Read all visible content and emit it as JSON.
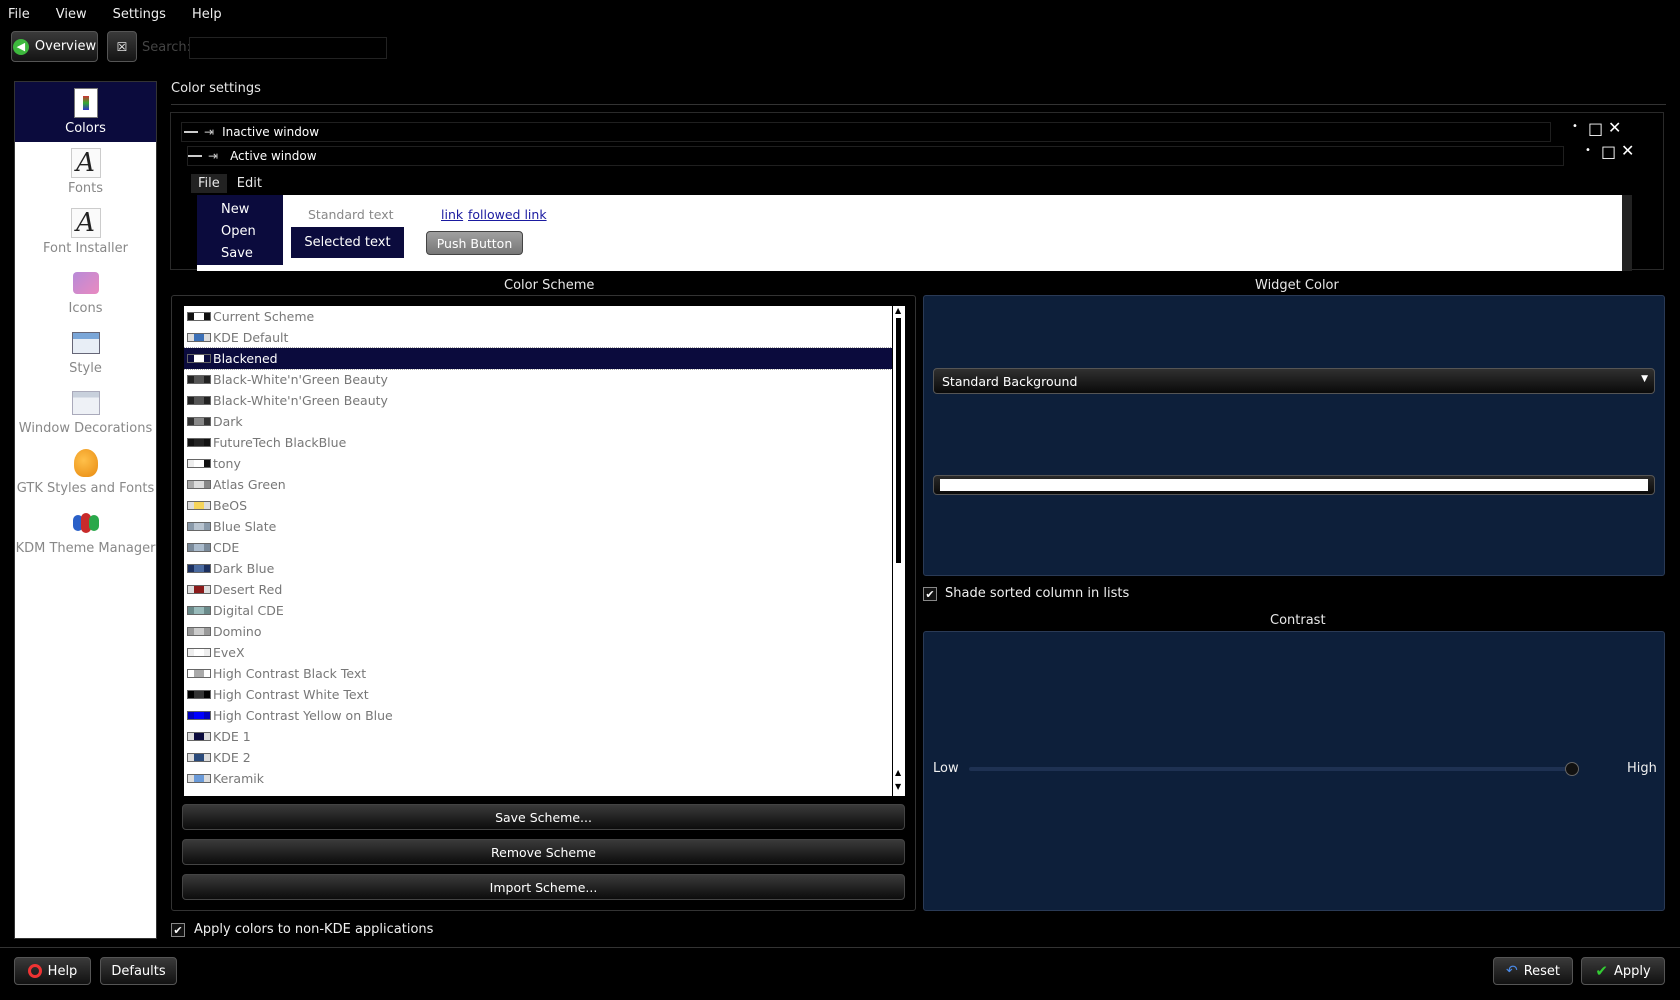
{
  "menubar": {
    "items": [
      "File",
      "View",
      "Settings",
      "Help"
    ]
  },
  "toolbar": {
    "overview_label": "Overview",
    "search_label": "Search:",
    "search_value": ""
  },
  "sidebar": {
    "items": [
      {
        "label": "Colors",
        "icon": "colors-icon"
      },
      {
        "label": "Fonts",
        "icon": "fonts-icon"
      },
      {
        "label": "Font Installer",
        "icon": "font-installer-icon"
      },
      {
        "label": "Icons",
        "icon": "icons-icon"
      },
      {
        "label": "Style",
        "icon": "style-icon"
      },
      {
        "label": "Window Decorations",
        "icon": "window-decorations-icon"
      },
      {
        "label": "GTK Styles and Fonts",
        "icon": "gtk-icon"
      },
      {
        "label": "KDM Theme Manager",
        "icon": "kdm-icon"
      }
    ]
  },
  "main": {
    "title": "Color settings"
  },
  "preview": {
    "inactive_title": "Inactive window",
    "active_title": "Active window",
    "menu_file": "File",
    "menu_edit": "Edit",
    "menu_items": [
      "New",
      "Open",
      "Save"
    ],
    "standard_text": "Standard text",
    "selected_text": "Selected text",
    "link": "link",
    "followed_link": "followed link",
    "push_button": "Push Button"
  },
  "color_scheme": {
    "title": "Color Scheme",
    "items": [
      {
        "name": "Current Scheme",
        "swatch": [
          "#111",
          "#fff",
          "#111"
        ]
      },
      {
        "name": "KDE Default",
        "swatch": [
          "#ddd",
          "#3b6fb6",
          "#ddd"
        ]
      },
      {
        "name": "Blackened",
        "swatch": [
          "#0b0b3d",
          "#fff",
          "#0b0b3d"
        ],
        "selected": true
      },
      {
        "name": "Black-White'n'Green Beauty",
        "swatch": [
          "#222",
          "#555",
          "#222"
        ]
      },
      {
        "name": "Black-White'n'Green Beauty",
        "swatch": [
          "#222",
          "#555",
          "#222"
        ]
      },
      {
        "name": "Dark",
        "swatch": [
          "#333",
          "#888",
          "#333"
        ]
      },
      {
        "name": "FutureTech BlackBlue",
        "swatch": [
          "#111",
          "#222",
          "#111"
        ]
      },
      {
        "name": "tony",
        "swatch": [
          "#eee",
          "#fff",
          "#111"
        ]
      },
      {
        "name": "Atlas Green",
        "swatch": [
          "#aaa",
          "#ddd",
          "#888"
        ]
      },
      {
        "name": "BeOS",
        "swatch": [
          "#ddd",
          "#f5d45a",
          "#ddd"
        ]
      },
      {
        "name": "Blue Slate",
        "swatch": [
          "#8a9aaa",
          "#b8c4d0",
          "#8a9aaa"
        ]
      },
      {
        "name": "CDE",
        "swatch": [
          "#7a8a9a",
          "#aabbcc",
          "#7a8a9a"
        ]
      },
      {
        "name": "Dark Blue",
        "swatch": [
          "#1c3060",
          "#4a6aa0",
          "#1c3060"
        ]
      },
      {
        "name": "Desert Red",
        "swatch": [
          "#ddd",
          "#8a1a1a",
          "#ddd"
        ]
      },
      {
        "name": "Digital CDE",
        "swatch": [
          "#6a8a8a",
          "#99bbbb",
          "#6a8a8a"
        ]
      },
      {
        "name": "Domino",
        "swatch": [
          "#999",
          "#ccc",
          "#999"
        ]
      },
      {
        "name": "EveX",
        "swatch": [
          "#eee",
          "#fff",
          "#eee"
        ]
      },
      {
        "name": "High Contrast Black Text",
        "swatch": [
          "#fff",
          "#aaa",
          "#fff"
        ]
      },
      {
        "name": "High Contrast White Text",
        "swatch": [
          "#000",
          "#333",
          "#000"
        ]
      },
      {
        "name": "High Contrast Yellow on Blue",
        "swatch": [
          "#0000c0",
          "#0000ff",
          "#0000c0"
        ]
      },
      {
        "name": "KDE 1",
        "swatch": [
          "#ddd",
          "#0b0b3d",
          "#ddd"
        ]
      },
      {
        "name": "KDE 2",
        "swatch": [
          "#ddd",
          "#2a4a7a",
          "#ddd"
        ]
      },
      {
        "name": "Keramik",
        "swatch": [
          "#ddd",
          "#6a9ad8",
          "#ddd"
        ]
      }
    ],
    "save_label": "Save Scheme...",
    "remove_label": "Remove Scheme",
    "import_label": "Import Scheme..."
  },
  "widget_color": {
    "title": "Widget Color",
    "selected": "Standard Background",
    "swatch_color": "#ffffff",
    "shade_label": "Shade sorted column in lists",
    "shade_checked": true
  },
  "contrast": {
    "title": "Contrast",
    "low": "Low",
    "high": "High",
    "value": 1.0
  },
  "apply_nonkde_label": "Apply colors to non-KDE applications",
  "bottom": {
    "help": "Help",
    "defaults": "Defaults",
    "reset": "Reset",
    "apply": "Apply"
  },
  "colors": {
    "navy": "#0b0b3d",
    "panel_navy": "#0d1f3a",
    "link": "#1a1aa0"
  }
}
